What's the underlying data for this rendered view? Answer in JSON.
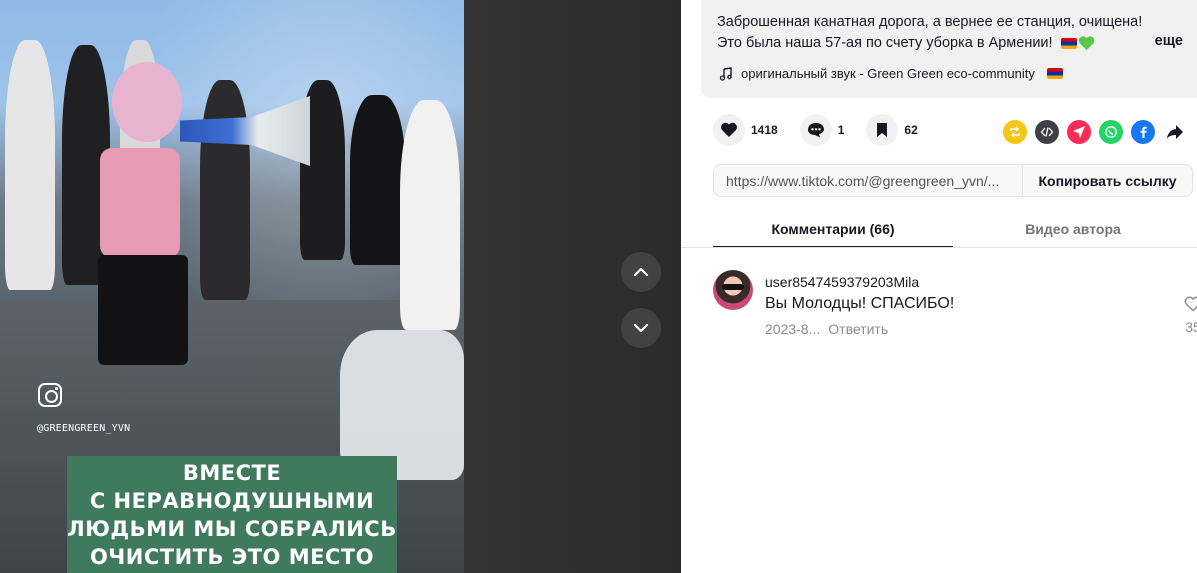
{
  "video": {
    "watermark_handle": "@GREENGREEN_YVN",
    "caption": "ВМЕСТЕ\nС НЕРАВНОДУШНЫМИ\nЛЮДЬМИ МЫ СОБРАЛИСЬ\nОЧИСТИТЬ ЭТО МЕСТО",
    "nav_up_icon": "chevron-up-icon",
    "nav_down_icon": "chevron-down-icon"
  },
  "description": {
    "line1": "Заброшенная канатная дорога, а вернее ее станция, очищена!",
    "line2": "Это была наша 57-ая по счету уборка в Армении!",
    "more_label": "еще",
    "sound_label": "оригинальный звук - Green  Green  eco-community"
  },
  "actions": {
    "likes": "1418",
    "comments": "1",
    "saves": "62"
  },
  "share": {
    "icons": [
      "repost-icon",
      "embed-icon",
      "send-icon",
      "whatsapp-icon",
      "facebook-icon",
      "share-arrow-icon"
    ],
    "colors": {
      "repost": "#f5c518",
      "embed": "#3e3e44",
      "send": "#fe2c55",
      "whatsapp": "#25d366",
      "facebook": "#1877f2"
    }
  },
  "link": {
    "url": "https://www.tiktok.com/@greengreen_yvn/...",
    "copy_label": "Копировать ссылку"
  },
  "tabs": {
    "comments": "Комментарии (66)",
    "author_videos": "Видео автора"
  },
  "comments": [
    {
      "user": "user8547459379203Mila",
      "text": "Вы Молодцы! СПАСИБО!",
      "date": "2023-8...",
      "reply_label": "Ответить",
      "likes": "35"
    }
  ],
  "colors": {
    "caption_bg": "#3f7a5d",
    "text_primary": "#161823",
    "text_secondary": "#8a8b91"
  }
}
